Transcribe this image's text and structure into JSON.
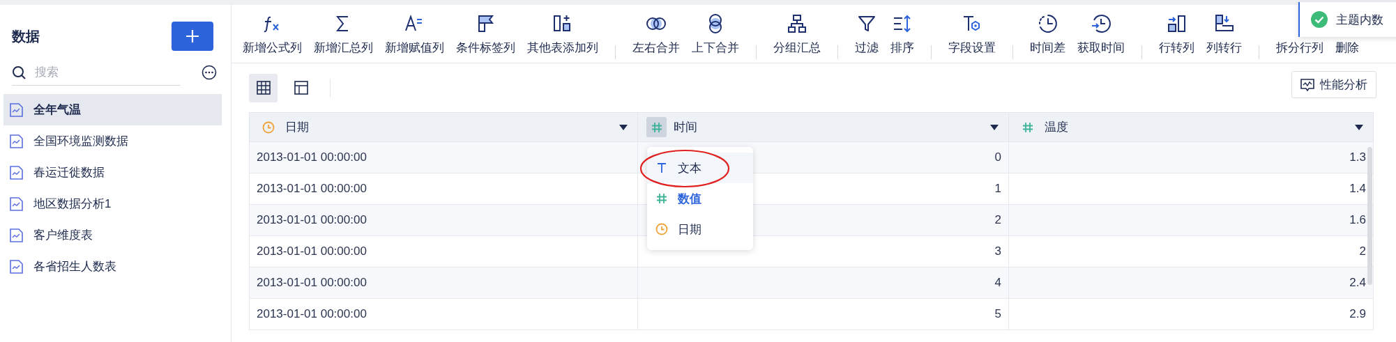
{
  "sidebar": {
    "title": "数据",
    "search": {
      "placeholder": "搜索"
    },
    "items": [
      {
        "label": "全年气温",
        "selected": true
      },
      {
        "label": "全国环境监测数据",
        "selected": false
      },
      {
        "label": "春运迁徙数据",
        "selected": false
      },
      {
        "label": "地区数据分析1",
        "selected": false
      },
      {
        "label": "客户维度表",
        "selected": false
      },
      {
        "label": "各省招生人数表",
        "selected": false
      }
    ]
  },
  "toolbar": {
    "groups": [
      [
        {
          "label": "新增公式列",
          "kind": "formula"
        },
        {
          "label": "新增汇总列",
          "kind": "sum"
        },
        {
          "label": "新增赋值列",
          "kind": "assign"
        },
        {
          "label": "条件标签列",
          "kind": "flag"
        },
        {
          "label": "其他表添加列",
          "kind": "addcol"
        }
      ],
      [
        {
          "label": "左右合并",
          "kind": "hmerge"
        },
        {
          "label": "上下合并",
          "kind": "vmerge"
        }
      ],
      [
        {
          "label": "分组汇总",
          "kind": "group"
        }
      ],
      [
        {
          "label": "过滤",
          "kind": "filter"
        },
        {
          "label": "排序",
          "kind": "sort"
        }
      ],
      [
        {
          "label": "字段设置",
          "kind": "field"
        }
      ],
      [
        {
          "label": "时间差",
          "kind": "timediff"
        },
        {
          "label": "获取时间",
          "kind": "gettime"
        }
      ],
      [
        {
          "label": "行转列",
          "kind": "row2col"
        },
        {
          "label": "列转行",
          "kind": "col2row"
        }
      ],
      [
        {
          "label": "拆分行列"
        },
        {
          "label": "删除"
        }
      ]
    ]
  },
  "toast": {
    "text": "主题内数"
  },
  "view_toggle": [
    {
      "kind": "grid",
      "selected": true
    },
    {
      "kind": "layout",
      "selected": false
    }
  ],
  "perf_button": {
    "label": "性能分析"
  },
  "table": {
    "columns": [
      {
        "name": "日期",
        "kind": "date",
        "open": false
      },
      {
        "name": "时间",
        "kind": "number",
        "open": true
      },
      {
        "name": "温度",
        "kind": "number",
        "open": false
      }
    ],
    "rows": [
      [
        "2013-01-01 00:00:00",
        "0",
        "1.3"
      ],
      [
        "2013-01-01 00:00:00",
        "1",
        "1.4"
      ],
      [
        "2013-01-01 00:00:00",
        "2",
        "1.6"
      ],
      [
        "2013-01-01 00:00:00",
        "3",
        "2"
      ],
      [
        "2013-01-01 00:00:00",
        "4",
        "2.4"
      ],
      [
        "2013-01-01 00:00:00",
        "5",
        "2.9"
      ]
    ]
  },
  "type_menu": {
    "items": [
      {
        "label": "文本",
        "kind": "text",
        "selected": false,
        "hovered": true,
        "circled": true
      },
      {
        "label": "数值",
        "kind": "number",
        "selected": true,
        "hovered": false,
        "circled": false
      },
      {
        "label": "日期",
        "kind": "date",
        "selected": false,
        "hovered": false,
        "circled": false
      }
    ]
  }
}
